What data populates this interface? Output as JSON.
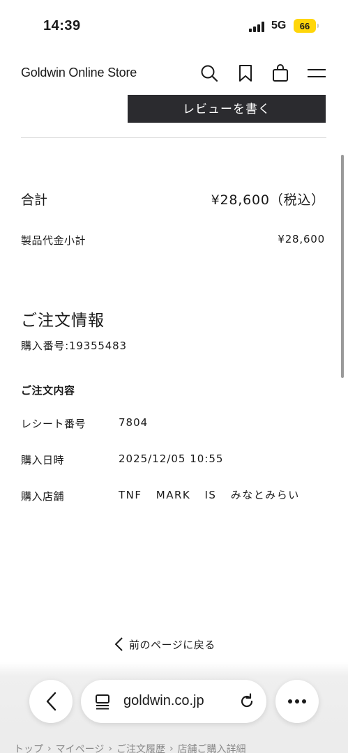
{
  "status_bar": {
    "time": "14:39",
    "network": "5G",
    "battery": "66"
  },
  "header": {
    "logo": "Goldwin Online Store"
  },
  "review_button_label": "レビューを書く",
  "summary": {
    "total_label": "合計",
    "total_value": "¥28,600（税込）",
    "subtotal_label": "製品代金小計",
    "subtotal_value": "¥28,600"
  },
  "order_info": {
    "title": "ご注文情報",
    "purchase_number": "購入番号:19355483",
    "detail_title": "ご注文内容",
    "rows": [
      {
        "label": "レシート番号",
        "value": "7804"
      },
      {
        "label": "購入日時",
        "value": "2025/12/05 10:55"
      },
      {
        "label": "購入店舗",
        "value": "TNF MARK IS みなとみらい"
      }
    ]
  },
  "back_link": "前のページに戻る",
  "browser": {
    "url": "goldwin.co.jp"
  },
  "breadcrumb": [
    "トップ",
    "マイページ",
    "ご注文履歴",
    "店舗ご購入詳細"
  ]
}
